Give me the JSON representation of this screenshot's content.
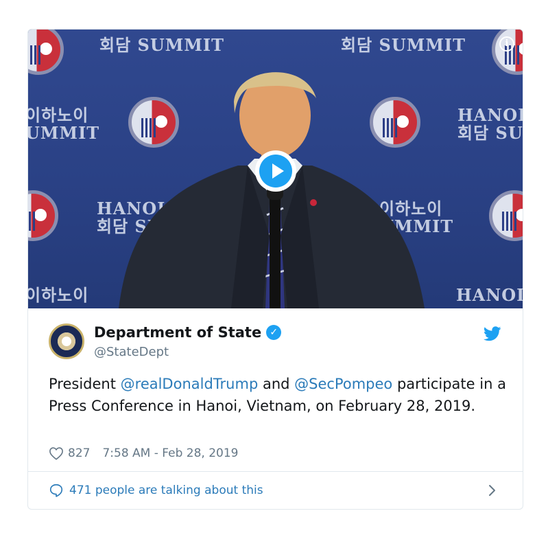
{
  "media": {
    "backdrop_texts": [
      "회담 SUMMIT",
      "회담 SUMMIT",
      "이하노이\nUMMIT",
      "HANOI\n회담 SU",
      "HANOI\n회담 SU",
      "이하노이\nUMMIT",
      "이하노이",
      "HANOI"
    ],
    "info_icon": "info-icon",
    "play_icon": "play-icon"
  },
  "tweet": {
    "account_name": "Department of State",
    "handle": "@StateDept",
    "text_parts": {
      "prefix": "President ",
      "mention1": "@realDonaldTrump",
      "middle": " and ",
      "mention2": "@SecPompeo",
      "suffix": " participate in a Press Conference in Hanoi, Vietnam, on February 28, 2019."
    },
    "likes": "827",
    "timestamp": "7:58 AM - Feb 28, 2019",
    "talking": "471 people are talking about this"
  },
  "colors": {
    "accent": "#1da1f2",
    "link": "#2b7bb9",
    "secondary_text": "#657786",
    "border": "#e1e8ed"
  }
}
